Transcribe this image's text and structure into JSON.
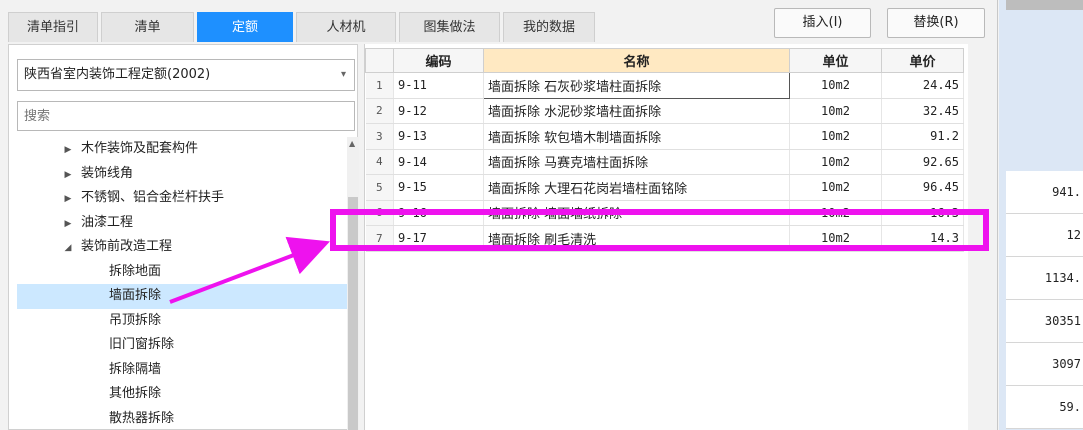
{
  "tabs": [
    {
      "label": "清单指引",
      "active": false
    },
    {
      "label": "清单",
      "active": false
    },
    {
      "label": "定额",
      "active": true
    },
    {
      "label": "人材机",
      "active": false
    },
    {
      "label": "图集做法",
      "active": false
    },
    {
      "label": "我的数据",
      "active": false
    }
  ],
  "buttons": {
    "insert": "插入(I)",
    "replace": "替换(R)"
  },
  "quota_library": {
    "selected": "陕西省室内装饰工程定额(2002)"
  },
  "search": {
    "placeholder": "搜索"
  },
  "tree": {
    "nodes": [
      {
        "label": "木作装饰及配套构件",
        "expanded": false
      },
      {
        "label": "装饰线角",
        "expanded": false
      },
      {
        "label": "不锈钢、铝合金栏杆扶手",
        "expanded": false
      },
      {
        "label": "油漆工程",
        "expanded": false
      },
      {
        "label": "装饰前改造工程",
        "expanded": true
      }
    ],
    "children": [
      {
        "label": "拆除地面",
        "selected": false
      },
      {
        "label": "墙面拆除",
        "selected": true
      },
      {
        "label": "吊顶拆除",
        "selected": false
      },
      {
        "label": "旧门窗拆除",
        "selected": false
      },
      {
        "label": "拆除隔墙",
        "selected": false
      },
      {
        "label": "其他拆除",
        "selected": false
      },
      {
        "label": "散热器拆除",
        "selected": false
      }
    ]
  },
  "table": {
    "headers": {
      "code": "编码",
      "name": "名称",
      "unit": "单位",
      "price": "单价"
    },
    "rows": [
      {
        "idx": "1",
        "code": "9-11",
        "name": "墙面拆除 石灰砂浆墙柱面拆除",
        "unit": "10m2",
        "price": "24.45"
      },
      {
        "idx": "2",
        "code": "9-12",
        "name": "墙面拆除 水泥砂浆墙柱面拆除",
        "unit": "10m2",
        "price": "32.45"
      },
      {
        "idx": "3",
        "code": "9-13",
        "name": "墙面拆除 软包墙木制墙面拆除",
        "unit": "10m2",
        "price": "91.2"
      },
      {
        "idx": "4",
        "code": "9-14",
        "name": "墙面拆除 马赛克墙柱面拆除",
        "unit": "10m2",
        "price": "92.65"
      },
      {
        "idx": "5",
        "code": "9-15",
        "name": "墙面拆除 大理石花岗岩墙柱面铭除",
        "unit": "10m2",
        "price": "96.45"
      },
      {
        "idx": "6",
        "code": "9-16",
        "name": "墙面拆除 墙面墙纸拆除",
        "unit": "10m2",
        "price": "16.3"
      },
      {
        "idx": "7",
        "code": "9-17",
        "name": "墙面拆除 刷毛清洗",
        "unit": "10m2",
        "price": "14.3"
      }
    ]
  },
  "background_values": [
    "941.",
    "12",
    "1134.",
    "30351",
    "3097",
    "59."
  ],
  "colors": {
    "accent": "#1e90ff",
    "highlight": "#ee12ee",
    "selected_row": "#cce8ff",
    "header_name": "#ffe9c2"
  }
}
